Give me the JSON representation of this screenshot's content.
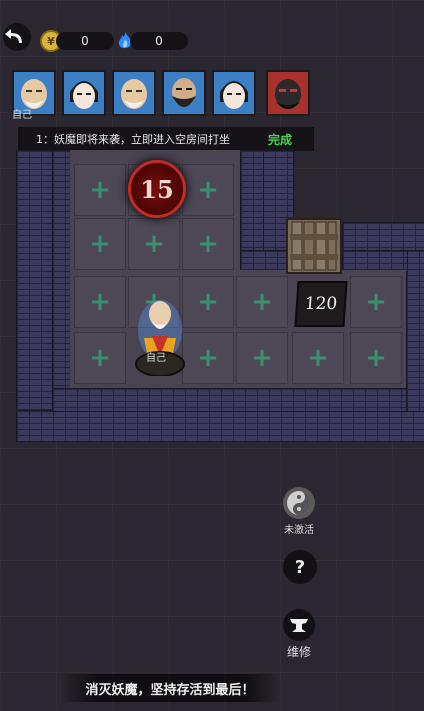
{
  "hud": {
    "gold_value": "0",
    "soul_value": "0",
    "gold_icon": "coin-icon",
    "soul_icon": "blue-flame-icon",
    "back_icon": "back-arrow-icon"
  },
  "party": {
    "self_label": "自己",
    "portraits": [
      {
        "name": "old-monk-portrait",
        "bg": "#3d7fc4"
      },
      {
        "name": "young-girl-portrait",
        "bg": "#3d7fc4"
      },
      {
        "name": "old-monk-portrait-2",
        "bg": "#3d7fc4"
      },
      {
        "name": "bearded-warrior-portrait",
        "bg": "#3d7fc4"
      },
      {
        "name": "young-girl-portrait-2",
        "bg": "#3d7fc4"
      },
      {
        "name": "demon-portrait",
        "bg": "#a8322e"
      }
    ]
  },
  "quest": {
    "text": "1：妖魔即将来袭，立即进入空房间打坐",
    "status": "完成",
    "status_color": "#4ed24e"
  },
  "board": {
    "timer_value": "15",
    "door_hp": "120",
    "player_label": "自己",
    "tile_symbol": "+"
  },
  "side_buttons": {
    "yinyang_label": "未激活",
    "help_symbol": "?",
    "repair_label": "维修"
  },
  "footer": {
    "text": "消灭妖魔，坚持存活到最后！"
  }
}
